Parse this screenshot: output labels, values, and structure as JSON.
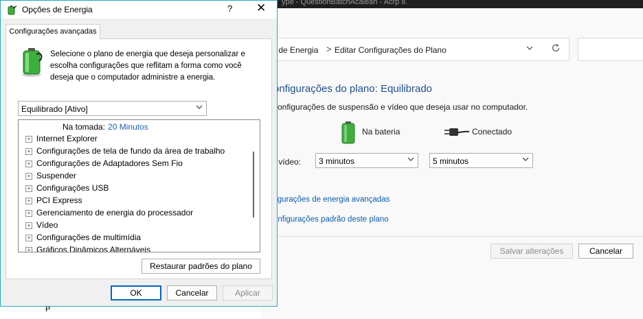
{
  "background_window": {
    "title_fragment": "ype - QuestionBatchAcaleah - Acrp 8.",
    "breadcrumb": {
      "prev": "s de Energia",
      "separator": ">",
      "current": "Editar Configurações do Plano"
    },
    "heading": "onfigurações do plano: Equilibrado",
    "subheading": "configurações de suspensão e vídeo que deseja usar no computador.",
    "columns": {
      "battery": "Na bateria",
      "plugged": "Conectado"
    },
    "row_label": "r vídeo:",
    "battery_value": "3 minutos",
    "plugged_value": "5 minutos",
    "links": {
      "advanced": "figurações de energia avançadas",
      "defaults": "onfigurações padrão deste plano"
    },
    "buttons": {
      "save": "Salvar alterações",
      "cancel": "Cancelar"
    },
    "stub_text": "P"
  },
  "dialog": {
    "title": "Opções de Energia",
    "help": "?",
    "close": "✕",
    "tab": "Configurações avançadas",
    "description": "Selecione o plano de energia que deseja personalizar e escolha configurações que reflitam a forma como você deseja que o computador administre a energia.",
    "plan": "Equilibrado [Ativo]",
    "tree_sub": {
      "label": "Na tomada:",
      "value": "20 Minutos"
    },
    "tree_items": [
      "Internet Explorer",
      "Configurações de tela de fundo da área de trabalho",
      "Configurações de Adaptadores Sem Fio",
      "Suspender",
      "Configurações USB",
      "PCI Express",
      "Gerenciamento de energia do processador",
      "Vídeo",
      "Configurações de multimídia",
      "Gráficos Dinâmicos Alternáveis"
    ],
    "expand_glyph": "+",
    "restore_button": "Restaurar padrões do plano",
    "ok": "OK",
    "cancel": "Cancelar",
    "apply": "Aplicar"
  },
  "colors": {
    "accent": "#0067c0",
    "link": "#0b5cad",
    "heading": "#1e4e8c",
    "dialog_border": "#2aa8c0"
  },
  "icons": [
    "battery-icon",
    "plug-icon",
    "power-options-icon",
    "help-icon",
    "close-icon",
    "chevron-down-icon",
    "refresh-icon",
    "expand-icon"
  ]
}
